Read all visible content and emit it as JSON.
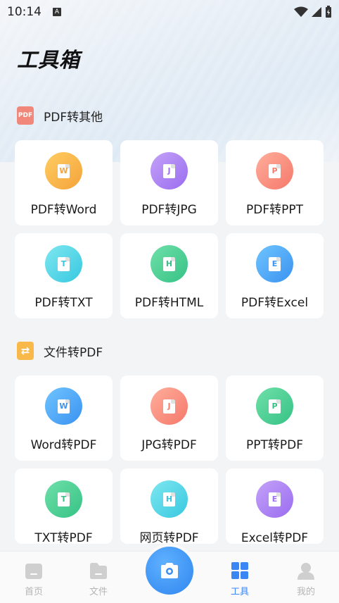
{
  "status_bar": {
    "time": "10:14",
    "notif_letter": "A"
  },
  "page": {
    "title": "工具箱"
  },
  "sections": [
    {
      "title": "PDF转其他",
      "icon_text": "PDF",
      "icon": "pdf-file-icon",
      "color": "#f0877a",
      "items": [
        {
          "label": "PDF转Word",
          "letter": "W",
          "icon": "word-doc-icon",
          "grad": [
            "#ffcd62",
            "#f4a33a"
          ],
          "letter_color": "#f3a43a"
        },
        {
          "label": "PDF转JPG",
          "letter": "J",
          "icon": "jpg-doc-icon",
          "grad": [
            "#c4a2f8",
            "#9a6cf0"
          ],
          "letter_color": "#9c72ef"
        },
        {
          "label": "PDF转PPT",
          "letter": "P",
          "icon": "ppt-doc-icon",
          "grad": [
            "#ffae9c",
            "#f5786a"
          ],
          "letter_color": "#f37c6c"
        },
        {
          "label": "PDF转TXT",
          "letter": "T",
          "icon": "txt-doc-icon",
          "grad": [
            "#7ee7f0",
            "#38c8e0"
          ],
          "letter_color": "#39c6dd"
        },
        {
          "label": "PDF转HTML",
          "letter": "H",
          "icon": "html-doc-icon",
          "grad": [
            "#6fe0a9",
            "#36c285"
          ],
          "letter_color": "#37bf84"
        },
        {
          "label": "PDF转Excel",
          "letter": "E",
          "icon": "excel-doc-icon",
          "grad": [
            "#70c4ff",
            "#3a93f0"
          ],
          "letter_color": "#3b95ef"
        }
      ]
    },
    {
      "title": "文件转PDF",
      "icon_text": "⇄",
      "icon": "convert-file-icon",
      "color": "#f9b94a",
      "items": [
        {
          "label": "Word转PDF",
          "letter": "W",
          "icon": "word-doc-icon",
          "grad": [
            "#70c4ff",
            "#3a93f0"
          ],
          "letter_color": "#3b95ef"
        },
        {
          "label": "JPG转PDF",
          "letter": "J",
          "icon": "jpg-doc-icon",
          "grad": [
            "#ffae9c",
            "#f5786a"
          ],
          "letter_color": "#f37c6c"
        },
        {
          "label": "PPT转PDF",
          "letter": "P",
          "icon": "ppt-doc-icon",
          "grad": [
            "#6fe0a9",
            "#36c285"
          ],
          "letter_color": "#37bf84"
        },
        {
          "label": "TXT转PDF",
          "letter": "T",
          "icon": "txt-doc-icon",
          "grad": [
            "#6fe0a9",
            "#36c285"
          ],
          "letter_color": "#37bf84"
        },
        {
          "label": "网页转PDF",
          "letter": "H",
          "icon": "html-doc-icon",
          "grad": [
            "#7ee7f0",
            "#38c8e0"
          ],
          "letter_color": "#39c6dd"
        },
        {
          "label": "Excel转PDF",
          "letter": "E",
          "icon": "excel-doc-icon",
          "grad": [
            "#c4a2f8",
            "#9a6cf0"
          ],
          "letter_color": "#9c72ef"
        }
      ]
    }
  ],
  "tabbar": {
    "items": [
      {
        "label": "首页",
        "icon": "home-icon",
        "active": false
      },
      {
        "label": "文件",
        "icon": "folder-icon",
        "active": false
      },
      {
        "label": "工具",
        "icon": "grid-icon",
        "active": true
      },
      {
        "label": "我的",
        "icon": "user-icon",
        "active": false
      }
    ],
    "camera_icon": "camera-icon"
  },
  "colors": {
    "accent": "#3a86f4",
    "inactive": "#b5b5b5"
  }
}
